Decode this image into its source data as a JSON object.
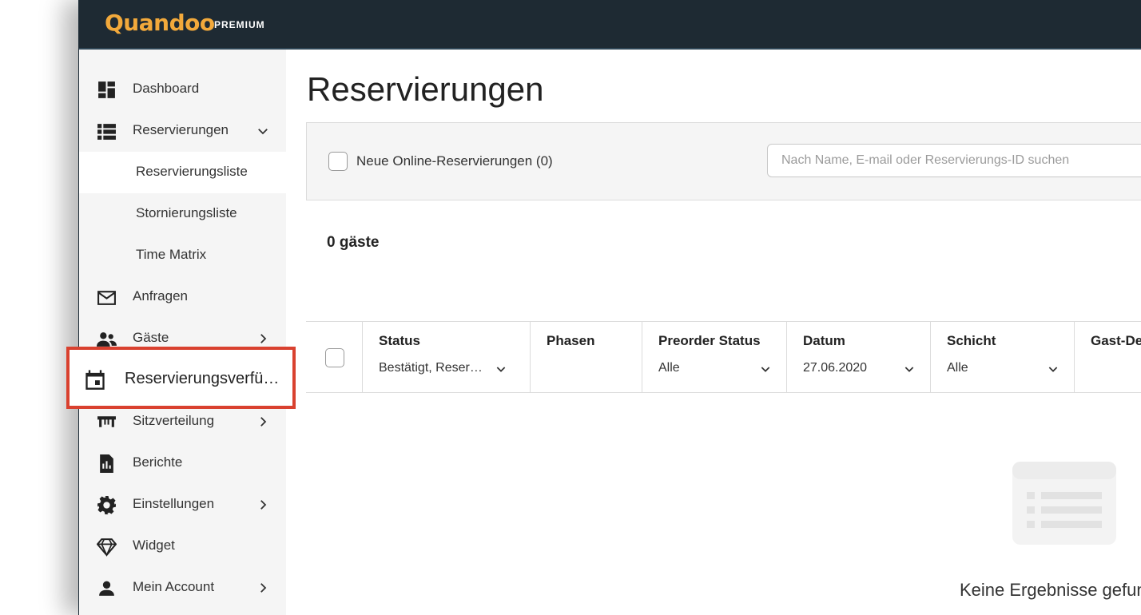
{
  "brand": {
    "name": "Quandoo",
    "tier": "PREMIUM",
    "accent": "#f2a93b"
  },
  "sidebar": {
    "items": [
      {
        "label": "Dashboard",
        "icon": "dashboard-icon"
      },
      {
        "label": "Reservierungen",
        "icon": "list-icon",
        "expanded": true
      },
      {
        "label": "Anfragen",
        "icon": "mail-icon"
      },
      {
        "label": "Gäste",
        "icon": "people-icon"
      },
      {
        "label": "Reservierungsverfü…",
        "icon": "calendar-icon",
        "highlighted": true
      },
      {
        "label": "Sitzverteilung",
        "icon": "table-icon"
      },
      {
        "label": "Berichte",
        "icon": "report-icon"
      },
      {
        "label": "Einstellungen",
        "icon": "gear-icon"
      },
      {
        "label": "Widget",
        "icon": "diamond-icon"
      },
      {
        "label": "Mein Account",
        "icon": "person-icon"
      }
    ],
    "subitems": [
      {
        "label": "Reservierungsliste",
        "active": true
      },
      {
        "label": "Stornierungsliste"
      },
      {
        "label": "Time Matrix"
      }
    ]
  },
  "main": {
    "title": "Reservierungen",
    "filter": {
      "new_online_label": "Neue Online-Reservierungen (0)",
      "search_placeholder": "Nach Name, E-mail oder Reservierungs-ID suchen"
    },
    "guest_count": "0 gäste",
    "columns": [
      {
        "header": "Status",
        "value": "Bestätigt, Reser…"
      },
      {
        "header": "Phasen",
        "value": ""
      },
      {
        "header": "Preorder Status",
        "value": "Alle"
      },
      {
        "header": "Datum",
        "value": "27.06.2020"
      },
      {
        "header": "Schicht",
        "value": "Alle"
      },
      {
        "header": "Gast-De",
        "value": ""
      }
    ],
    "empty_message": "Keine Ergebnisse gefunden"
  },
  "colors": {
    "topbar": "#1e2a33",
    "highlight_border": "#d9412f",
    "sidebar_bg": "#f5f5f5"
  }
}
